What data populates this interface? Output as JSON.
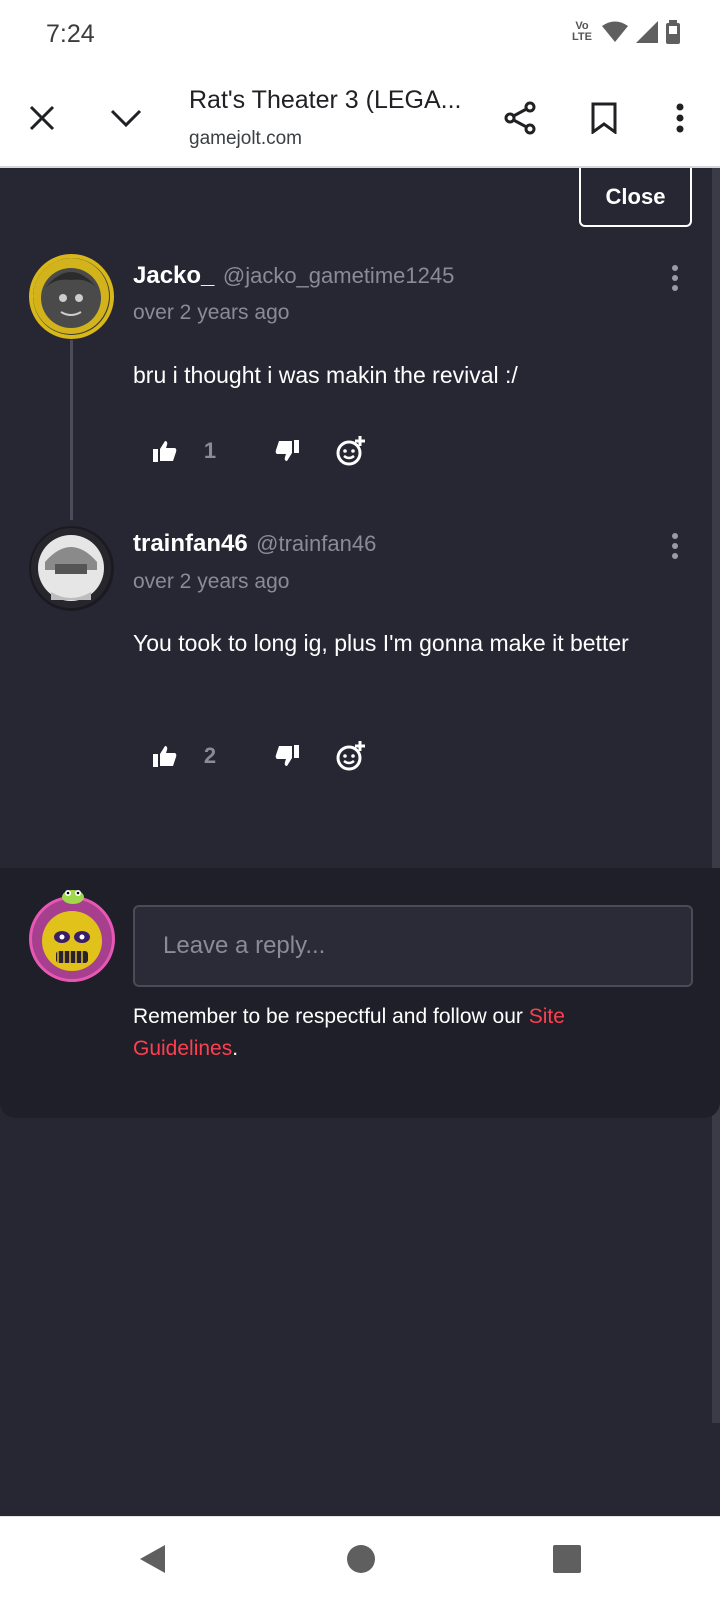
{
  "status_bar": {
    "time": "7:24",
    "network_label": "Vo LTE"
  },
  "browser": {
    "title": "Rat's Theater 3 (LEGA...",
    "url": "gamejolt.com"
  },
  "panel": {
    "close_label": "Close"
  },
  "comments": [
    {
      "author": "Jacko_",
      "handle": "@jacko_gametime1245",
      "time": "over 2 years ago",
      "text": "bru i thought i was makin the revival :/",
      "likes": "1"
    },
    {
      "author": "trainfan46",
      "handle": "@trainfan46",
      "time": "over 2 years ago",
      "text": "You took to long ig, plus I'm gonna make it better",
      "likes": "2"
    }
  ],
  "reply": {
    "placeholder": "Leave a reply...",
    "note_prefix": "Remember to be respectful and follow our ",
    "link_text": "Site Guidelines",
    "note_suffix": "."
  },
  "colors": {
    "background": "#262733",
    "reply_area": "#1e1f28",
    "link": "#ff3f50",
    "muted_text": "#8a8b96"
  },
  "icons": [
    "close-icon",
    "chevron-down-icon",
    "share-icon",
    "bookmark-icon",
    "more-vert-icon",
    "thumbs-up-icon",
    "thumbs-down-icon",
    "emoji-add-icon",
    "back-icon",
    "home-icon",
    "recents-icon",
    "wifi-icon",
    "signal-icon",
    "battery-icon"
  ]
}
